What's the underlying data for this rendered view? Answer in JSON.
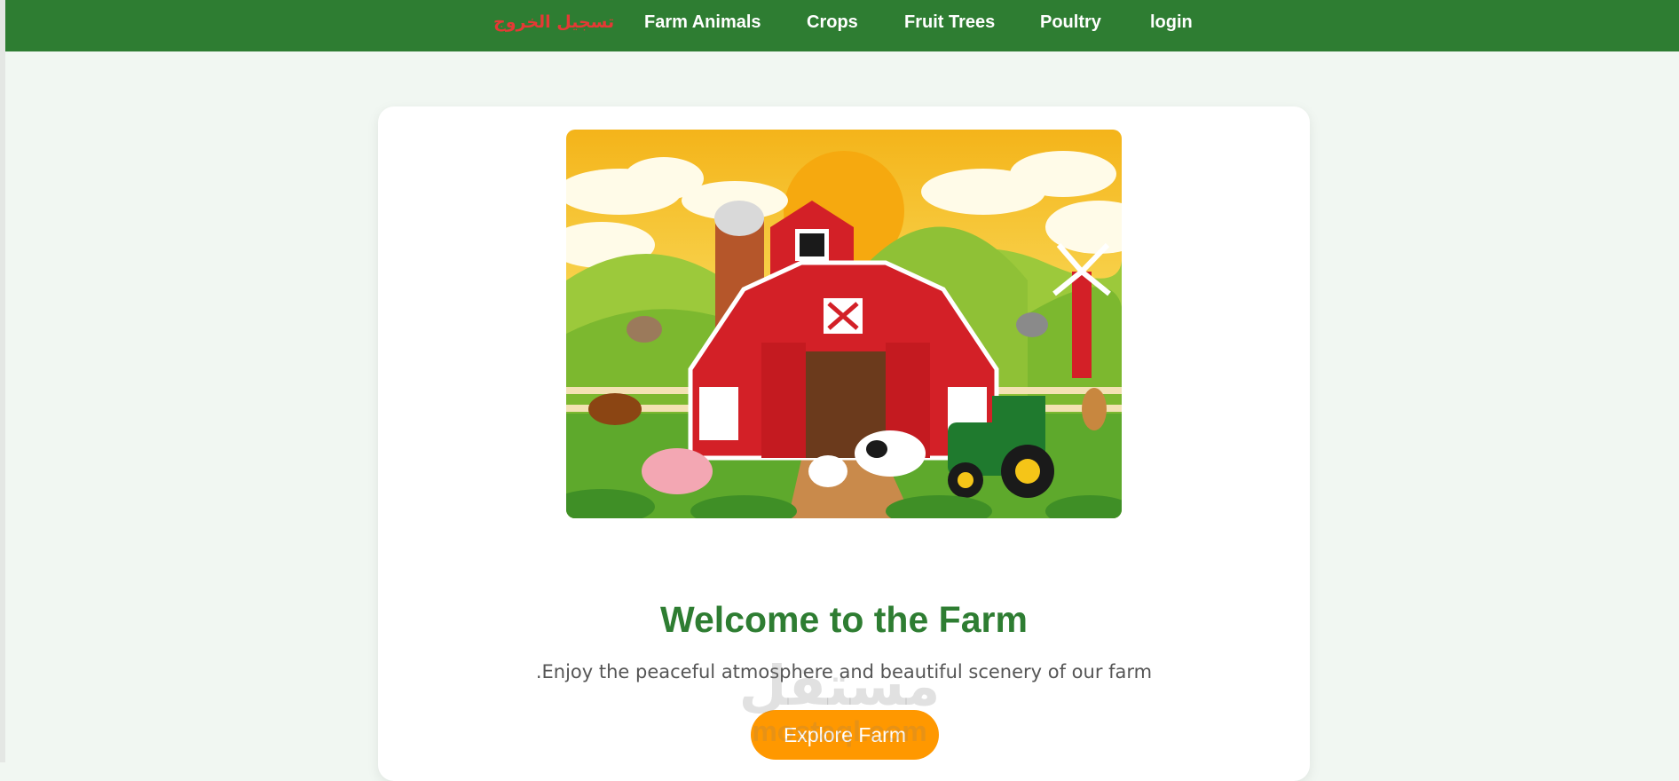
{
  "nav": {
    "logout_label": "تسجيل الخروج",
    "items": [
      {
        "label": "Farm Animals"
      },
      {
        "label": "Crops"
      },
      {
        "label": "Fruit Trees"
      },
      {
        "label": "Poultry"
      },
      {
        "label": "login"
      }
    ]
  },
  "hero": {
    "image": "farm-illustration"
  },
  "main": {
    "title": "Welcome to the Farm",
    "subtitle": ".Enjoy the peaceful atmosphere and beautiful scenery of our farm",
    "button_label": "Explore Farm"
  },
  "watermark": {
    "text": "مستقل",
    "subtext": "mostaql.com"
  },
  "colors": {
    "nav_bg": "#2e7d32",
    "accent": "#ff9800",
    "logout": "#e53935",
    "title": "#2e7d32"
  }
}
